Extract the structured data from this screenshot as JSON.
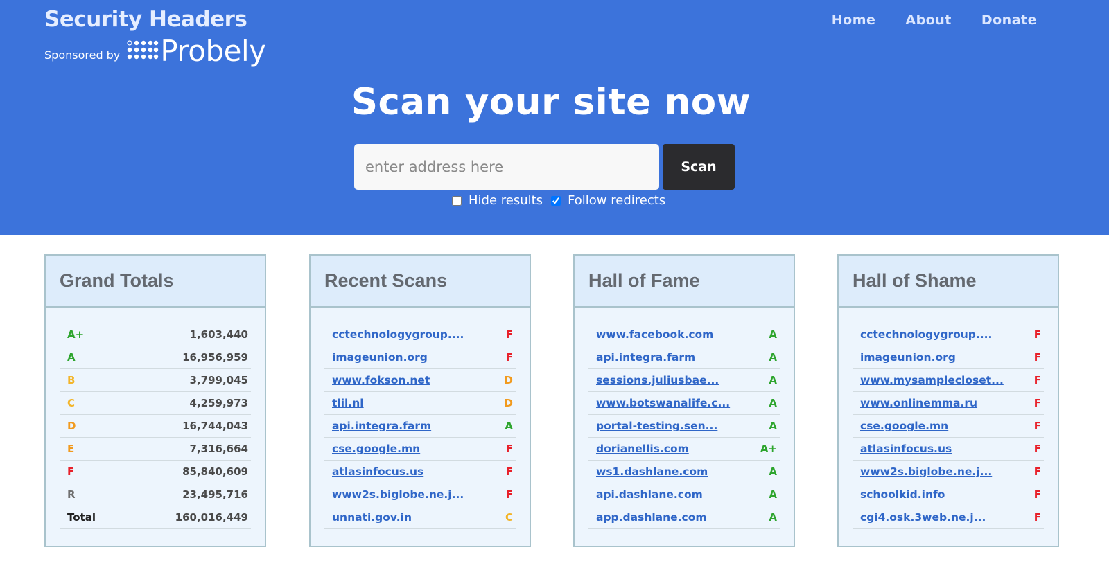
{
  "brand": {
    "title": "Security Headers",
    "sponsored_by": "Sponsored by",
    "sponsor_name": "Probely"
  },
  "nav": [
    {
      "label": "Home"
    },
    {
      "label": "About"
    },
    {
      "label": "Donate"
    }
  ],
  "hero": {
    "headline": "Scan your site now",
    "input_placeholder": "enter address here",
    "scan_label": "Scan",
    "hide_results_label": "Hide results",
    "hide_results_checked": false,
    "follow_redirects_label": "Follow redirects",
    "follow_redirects_checked": true
  },
  "colors": {
    "header_bg": "#3c73db",
    "grade_green": "#2ea52e",
    "grade_yellow": "#f3b52a",
    "grade_orange": "#f19a1e",
    "grade_red": "#e8202a",
    "grade_gray": "#707070",
    "link": "#2f66c8"
  },
  "grand_totals": {
    "title": "Grand Totals",
    "rows": [
      {
        "grade": "A+",
        "count": "1,603,440",
        "color": "green"
      },
      {
        "grade": "A",
        "count": "16,956,959",
        "color": "green"
      },
      {
        "grade": "B",
        "count": "3,799,045",
        "color": "yellow"
      },
      {
        "grade": "C",
        "count": "4,259,973",
        "color": "yellow"
      },
      {
        "grade": "D",
        "count": "16,744,043",
        "color": "orange"
      },
      {
        "grade": "E",
        "count": "7,316,664",
        "color": "orange"
      },
      {
        "grade": "F",
        "count": "85,840,609",
        "color": "red"
      },
      {
        "grade": "R",
        "count": "23,495,716",
        "color": "gray"
      }
    ],
    "total_label": "Total",
    "total_count": "160,016,449"
  },
  "recent_scans": {
    "title": "Recent Scans",
    "rows": [
      {
        "site": "cctechnologygroup....",
        "grade": "F",
        "color": "red"
      },
      {
        "site": "imageunion.org",
        "grade": "F",
        "color": "red"
      },
      {
        "site": "www.fokson.net",
        "grade": "D",
        "color": "orange"
      },
      {
        "site": "tlil.nl",
        "grade": "D",
        "color": "orange"
      },
      {
        "site": "api.integra.farm",
        "grade": "A",
        "color": "green"
      },
      {
        "site": "cse.google.mn",
        "grade": "F",
        "color": "red"
      },
      {
        "site": "atlasinfocus.us",
        "grade": "F",
        "color": "red"
      },
      {
        "site": "www2s.biglobe.ne.j...",
        "grade": "F",
        "color": "red"
      },
      {
        "site": "unnati.gov.in",
        "grade": "C",
        "color": "yellow"
      }
    ]
  },
  "hall_of_fame": {
    "title": "Hall of Fame",
    "rows": [
      {
        "site": "www.facebook.com",
        "grade": "A",
        "color": "green"
      },
      {
        "site": "api.integra.farm",
        "grade": "A",
        "color": "green"
      },
      {
        "site": "sessions.juliusbae...",
        "grade": "A",
        "color": "green"
      },
      {
        "site": "www.botswanalife.c...",
        "grade": "A",
        "color": "green"
      },
      {
        "site": "portal-testing.sen...",
        "grade": "A",
        "color": "green"
      },
      {
        "site": "dorianellis.com",
        "grade": "A+",
        "color": "green"
      },
      {
        "site": "ws1.dashlane.com",
        "grade": "A",
        "color": "green"
      },
      {
        "site": "api.dashlane.com",
        "grade": "A",
        "color": "green"
      },
      {
        "site": "app.dashlane.com",
        "grade": "A",
        "color": "green"
      }
    ]
  },
  "hall_of_shame": {
    "title": "Hall of Shame",
    "rows": [
      {
        "site": "cctechnologygroup....",
        "grade": "F",
        "color": "red"
      },
      {
        "site": "imageunion.org",
        "grade": "F",
        "color": "red"
      },
      {
        "site": "www.mysamplecloset...",
        "grade": "F",
        "color": "red"
      },
      {
        "site": "www.onlinemma.ru",
        "grade": "F",
        "color": "red"
      },
      {
        "site": "cse.google.mn",
        "grade": "F",
        "color": "red"
      },
      {
        "site": "atlasinfocus.us",
        "grade": "F",
        "color": "red"
      },
      {
        "site": "www2s.biglobe.ne.j...",
        "grade": "F",
        "color": "red"
      },
      {
        "site": "schoolkid.info",
        "grade": "F",
        "color": "red"
      },
      {
        "site": "cgi4.osk.3web.ne.j...",
        "grade": "F",
        "color": "red"
      }
    ]
  }
}
